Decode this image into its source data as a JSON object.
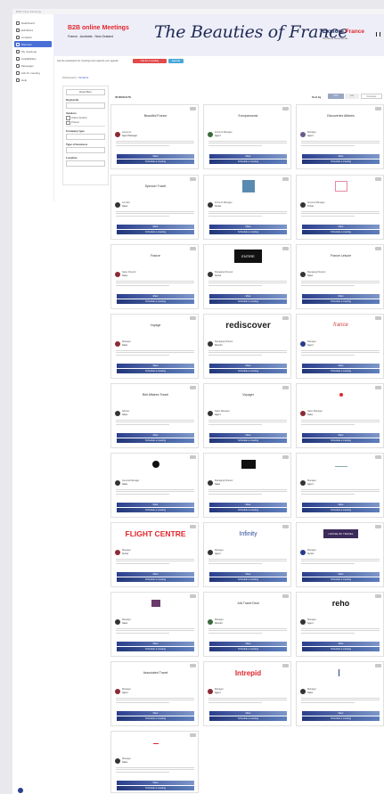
{
  "topbar": {
    "text": "B2B Online Meetings"
  },
  "sidebar": {
    "items": [
      {
        "label": "Dashboard",
        "active": false
      },
      {
        "label": "Exhibitors",
        "active": false
      },
      {
        "label": "Contacts",
        "active": false
      },
      {
        "label": "Discover",
        "active": true
      },
      {
        "label": "My meetings",
        "active": false
      },
      {
        "label": "Availabilities",
        "active": false
      },
      {
        "label": "Messages",
        "active": false
      },
      {
        "label": "Ask for meeting",
        "active": false
      },
      {
        "label": "Help",
        "active": false
      }
    ]
  },
  "banner": {
    "title": "B2B online Meetings",
    "subtitle": "France - Australia - New Zealand",
    "script": "The Beauties of France",
    "brand_a": "Explore ",
    "brand_b": "France",
    "tagline": "Tourisme Decouverte"
  },
  "infobar": {
    "text": "Ask the participants for meetings and organize your agenda",
    "btn_red": "Ask for a meeting",
    "btn_blue": "Agenda"
  },
  "breadcrumb": {
    "home": "Participants",
    "current": "Vendors"
  },
  "filters": {
    "reset": "Reset filters",
    "label_name": "Keywords",
    "label_type": "Vendors",
    "check_a": "Online Vendors",
    "check_b": "Present",
    "label_company": "Company type",
    "label_country": "Type of business",
    "label_location": "Location"
  },
  "results": {
    "count": "35 RESULTS",
    "sort": "Sort by",
    "view_a": "Grid",
    "view_b": "List",
    "view_c": "Favorites"
  },
  "buttons": {
    "meet": "Meet",
    "schedule": "Schedule a meeting"
  },
  "cards": [
    {
      "logo": "Beautiful France",
      "style": "text",
      "name": "Laurence",
      "role": "Agent Manager",
      "av": "#8a2a35"
    },
    {
      "logo": "Europamundo",
      "style": "text",
      "name": "Account Manager",
      "role": "Agent",
      "av": "#3a6a3a"
    },
    {
      "logo": "Discoveries Affaires",
      "style": "text",
      "name": "Manager",
      "role": "Agent",
      "av": "#6a5a8a"
    },
    {
      "logo": "Spencer Travel",
      "style": "text",
      "name": "Jennifer",
      "role": "Sales",
      "av": "#333"
    },
    {
      "logo": "",
      "style": "box",
      "name": "Account Manager",
      "role": "Senior",
      "av": "#333"
    },
    {
      "logo": "",
      "style": "pink",
      "name": "Account Manager",
      "role": "Travel",
      "av": "#333"
    },
    {
      "logo": "France",
      "style": "text",
      "name": "Sales Director",
      "role": "Sales",
      "av": "#8a2a35"
    },
    {
      "logo": "ENTIRE",
      "style": "dark",
      "name": "Managing Director",
      "role": "Senior",
      "av": "#333"
    },
    {
      "logo": "France Leisure",
      "style": "text",
      "name": "Managing Director",
      "role": "Sales",
      "av": "#333"
    },
    {
      "logo": "Voyage",
      "style": "text",
      "name": "Manager",
      "role": "Sales",
      "av": "#8a2a35"
    },
    {
      "logo": "rediscover",
      "style": "big",
      "name": "Managing Director",
      "role": "Director",
      "av": "#333"
    },
    {
      "logo": "france",
      "style": "red",
      "name": "Manager",
      "role": "Agent",
      "av": "#2a3a8a"
    },
    {
      "logo": "Bell Affaires Travel",
      "style": "text",
      "name": "Adviser",
      "role": "Sales",
      "av": "#333"
    },
    {
      "logo": "Voyager",
      "style": "text",
      "name": "Sales Manager",
      "role": "Agent",
      "av": "#333"
    },
    {
      "logo": "",
      "style": "dot",
      "name": "Sales Manager",
      "role": "Sales",
      "av": "#8a2a35"
    },
    {
      "logo": "",
      "style": "circle",
      "name": "General Manager",
      "role": "Sales",
      "av": "#333"
    },
    {
      "logo": "",
      "style": "dark",
      "name": "Managing Director",
      "role": "Sales",
      "av": "#333"
    },
    {
      "logo": "",
      "style": "light",
      "name": "Manager",
      "role": "Agent",
      "av": "#333"
    },
    {
      "logo": "FLIGHT CENTRE",
      "style": "flight",
      "name": "Manager",
      "role": "Senior",
      "av": "#8a2a35"
    },
    {
      "logo": "Infinity",
      "style": "infinity",
      "name": "Manager",
      "role": "Agent",
      "av": "#333"
    },
    {
      "logo": "HOUSE OF TRAVEL",
      "style": "house",
      "name": "Manager",
      "role": "Senior",
      "av": "#2a3a8a"
    },
    {
      "logo": "",
      "style": "purple",
      "name": "Manager",
      "role": "Sales",
      "av": "#333"
    },
    {
      "logo": "AIA Travel Deal",
      "style": "text",
      "name": "Manager",
      "role": "Director",
      "av": "#3a6a3a"
    },
    {
      "logo": "reho",
      "style": "reho",
      "name": "Manager",
      "role": "Agent",
      "av": "#333"
    },
    {
      "logo": "Associated Travel",
      "style": "text",
      "name": "Manager",
      "role": "Agent",
      "av": "#8a2a35"
    },
    {
      "logo": "Intrepid",
      "style": "intrepid",
      "name": "Manager",
      "role": "Agent",
      "av": "#8a2a35"
    },
    {
      "logo": "",
      "style": "glyph",
      "name": "Manager",
      "role": "Sales",
      "av": "#333"
    },
    {
      "logo": "",
      "style": "small",
      "name": "Manager",
      "role": "Sales",
      "av": "#333"
    }
  ],
  "colors": {
    "accent": "#2b3f8e",
    "red": "#e1262d",
    "navy": "#1e2a55"
  }
}
